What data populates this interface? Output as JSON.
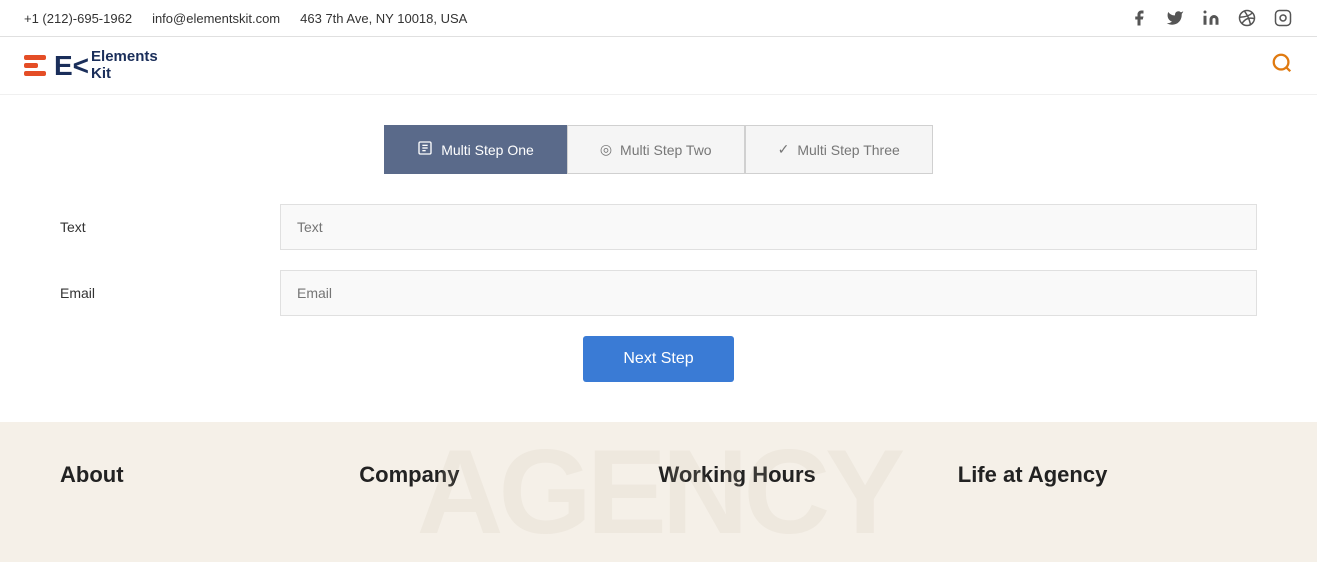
{
  "topbar": {
    "phone": "+1 (212)-695-1962",
    "email": "info@elementskit.com",
    "address": "463 7th Ave, NY 10018, USA"
  },
  "logo": {
    "elements": "Elements",
    "kit": "Kit",
    "ek_text": "E<"
  },
  "steps": [
    {
      "id": "step1",
      "label": "Multi Step One",
      "icon": "📋",
      "state": "active"
    },
    {
      "id": "step2",
      "label": "Multi Step Two",
      "icon": "◎",
      "state": "inactive"
    },
    {
      "id": "step3",
      "label": "Multi Step Three",
      "icon": "✓",
      "state": "inactive"
    }
  ],
  "form": {
    "text_label": "Text",
    "text_placeholder": "Text",
    "email_label": "Email",
    "email_placeholder": "Email",
    "next_step_label": "Next Step"
  },
  "footer": {
    "columns": [
      {
        "id": "about",
        "title": "About"
      },
      {
        "id": "company",
        "title": "Company"
      },
      {
        "id": "working-hours",
        "title": "Working Hours"
      },
      {
        "id": "life-at-agency",
        "title": "Life at Agency"
      }
    ]
  },
  "social": {
    "facebook": "f",
    "twitter": "t",
    "linkedin": "in",
    "dribbble": "◉",
    "instagram": "◻"
  }
}
